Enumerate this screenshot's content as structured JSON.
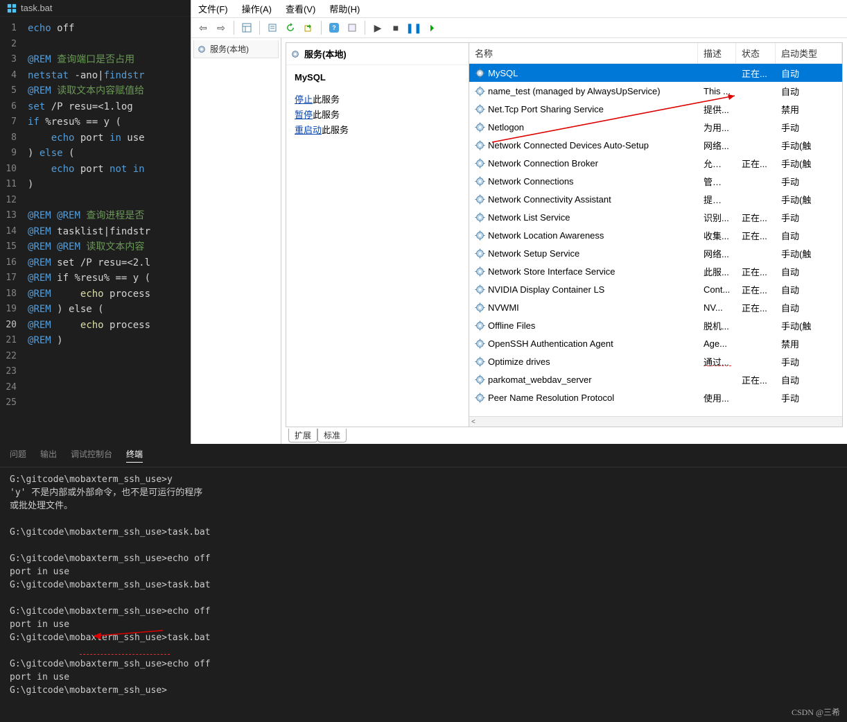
{
  "vscode": {
    "tab_name": "task.bat",
    "lines": [
      {
        "n": 1,
        "c": [
          [
            "kw",
            "echo"
          ],
          [
            "ident",
            " off"
          ]
        ]
      },
      {
        "n": 2,
        "c": []
      },
      {
        "n": 3,
        "c": [
          [
            "rem",
            "@"
          ],
          [
            "kw",
            "REM"
          ],
          [
            "cmt",
            " 查询端口是否占用"
          ]
        ]
      },
      {
        "n": 4,
        "c": [
          [
            "kw",
            "netstat"
          ],
          [
            "ident",
            " -ano|"
          ],
          [
            "kw",
            "findstr"
          ],
          [
            "ident",
            " "
          ]
        ]
      },
      {
        "n": 5,
        "c": [
          [
            "rem",
            "@"
          ],
          [
            "kw",
            "REM"
          ],
          [
            "cmt",
            " 读取文本内容赋值给"
          ]
        ]
      },
      {
        "n": 6,
        "c": [
          [
            "kw",
            "set"
          ],
          [
            "ident",
            " /P resu=<1.log"
          ]
        ]
      },
      {
        "n": 7,
        "c": [
          [
            "kw",
            "if"
          ],
          [
            "ident",
            " %resu% == y "
          ],
          [
            "op",
            "("
          ]
        ]
      },
      {
        "n": 8,
        "c": [
          [
            "ident",
            "    "
          ],
          [
            "kw",
            "echo"
          ],
          [
            "ident",
            " port "
          ],
          [
            "kw",
            "in"
          ],
          [
            "ident",
            " use"
          ]
        ]
      },
      {
        "n": 9,
        "c": [
          [
            "op",
            ")"
          ],
          [
            "ident",
            " "
          ],
          [
            "kw",
            "else"
          ],
          [
            "ident",
            " "
          ],
          [
            "op",
            "("
          ]
        ]
      },
      {
        "n": 10,
        "c": [
          [
            "ident",
            "    "
          ],
          [
            "kw",
            "echo"
          ],
          [
            "ident",
            " port "
          ],
          [
            "kw",
            "not"
          ],
          [
            "ident",
            " "
          ],
          [
            "kw",
            "in"
          ],
          [
            "ident",
            " "
          ]
        ]
      },
      {
        "n": 11,
        "c": [
          [
            "op",
            ")"
          ]
        ]
      },
      {
        "n": 12,
        "c": []
      },
      {
        "n": 13,
        "c": [
          [
            "rem",
            "@"
          ],
          [
            "kw",
            "REM"
          ],
          [
            "ident",
            " "
          ],
          [
            "rem",
            "@"
          ],
          [
            "kw",
            "REM"
          ],
          [
            "cmt",
            " 查询进程是否"
          ]
        ]
      },
      {
        "n": 14,
        "c": [
          [
            "rem",
            "@"
          ],
          [
            "kw",
            "REM"
          ],
          [
            "ident",
            " tasklist|findstr"
          ]
        ]
      },
      {
        "n": 15,
        "c": [
          [
            "rem",
            "@"
          ],
          [
            "kw",
            "REM"
          ],
          [
            "ident",
            " "
          ],
          [
            "rem",
            "@"
          ],
          [
            "kw",
            "REM"
          ],
          [
            "cmt",
            " 读取文本内容"
          ]
        ]
      },
      {
        "n": 16,
        "c": [
          [
            "rem",
            "@"
          ],
          [
            "kw",
            "REM"
          ],
          [
            "ident",
            " set /P resu=<2.l"
          ]
        ]
      },
      {
        "n": 17,
        "c": [
          [
            "rem",
            "@"
          ],
          [
            "kw",
            "REM"
          ],
          [
            "ident",
            " if %resu% == y ("
          ]
        ]
      },
      {
        "n": 18,
        "c": [
          [
            "rem",
            "@"
          ],
          [
            "kw",
            "REM"
          ],
          [
            "ident",
            "     "
          ],
          [
            "echo-w",
            "echo"
          ],
          [
            "ident",
            " process"
          ]
        ]
      },
      {
        "n": 19,
        "c": [
          [
            "rem",
            "@"
          ],
          [
            "kw",
            "REM"
          ],
          [
            "ident",
            " ) else ("
          ]
        ]
      },
      {
        "n": 20,
        "c": [
          [
            "rem",
            "@"
          ],
          [
            "kw",
            "REM"
          ],
          [
            "ident",
            "     "
          ],
          [
            "echo-w",
            "echo"
          ],
          [
            "ident",
            " process"
          ]
        ],
        "current": true
      },
      {
        "n": 21,
        "c": [
          [
            "rem",
            "@"
          ],
          [
            "kw",
            "REM"
          ],
          [
            "ident",
            " )"
          ]
        ]
      },
      {
        "n": 22,
        "c": []
      },
      {
        "n": 23,
        "c": []
      },
      {
        "n": 24,
        "c": []
      },
      {
        "n": 25,
        "c": []
      }
    ]
  },
  "terminal": {
    "tabs": [
      "问题",
      "输出",
      "调试控制台",
      "终端"
    ],
    "active_tab": 3,
    "body": "G:\\gitcode\\mobaxterm_ssh_use>y\n'y' 不是内部或外部命令，也不是可运行的程序\n或批处理文件。\n\nG:\\gitcode\\mobaxterm_ssh_use>task.bat\n\nG:\\gitcode\\mobaxterm_ssh_use>echo off\nport in use\nG:\\gitcode\\mobaxterm_ssh_use>task.bat\n\nG:\\gitcode\\mobaxterm_ssh_use>echo off\nport in use\nG:\\gitcode\\mobaxterm_ssh_use>task.bat\n\nG:\\gitcode\\mobaxterm_ssh_use>echo off\nport in use\nG:\\gitcode\\mobaxterm_ssh_use>"
  },
  "services": {
    "menu": [
      "文件(F)",
      "操作(A)",
      "查看(V)",
      "帮助(H)"
    ],
    "tree_label": "服务(本地)",
    "mid_header": "服务(本地)",
    "selected_service": "MySQL",
    "action_stop_prefix": "停止",
    "action_stop_suffix": "此服务",
    "action_pause_prefix": "暂停",
    "action_pause_suffix": "此服务",
    "action_restart_prefix": "重启动",
    "action_restart_suffix": "此服务",
    "columns": {
      "name": "名称",
      "desc": "描述",
      "status": "状态",
      "start": "启动类型"
    },
    "rows": [
      {
        "name": "MySQL",
        "desc": "",
        "status": "正在...",
        "start": "自动",
        "selected": true
      },
      {
        "name": "name_test (managed by AlwaysUpService)",
        "desc": "This ...",
        "status": "",
        "start": "自动"
      },
      {
        "name": "Net.Tcp Port Sharing Service",
        "desc": "提供...",
        "status": "",
        "start": "禁用"
      },
      {
        "name": "Netlogon",
        "desc": "为用...",
        "status": "",
        "start": "手动"
      },
      {
        "name": "Network Connected Devices Auto-Setup",
        "desc": "网络...",
        "status": "",
        "start": "手动(触"
      },
      {
        "name": "Network Connection Broker",
        "desc": "允许 ...",
        "status": "正在...",
        "start": "手动(触"
      },
      {
        "name": "Network Connections",
        "desc": "管理\"...",
        "status": "",
        "start": "手动"
      },
      {
        "name": "Network Connectivity Assistant",
        "desc": "提供 ...",
        "status": "",
        "start": "手动(触"
      },
      {
        "name": "Network List Service",
        "desc": "识别...",
        "status": "正在...",
        "start": "手动"
      },
      {
        "name": "Network Location Awareness",
        "desc": "收集...",
        "status": "正在...",
        "start": "自动"
      },
      {
        "name": "Network Setup Service",
        "desc": "网络...",
        "status": "",
        "start": "手动(触"
      },
      {
        "name": "Network Store Interface Service",
        "desc": "此服...",
        "status": "正在...",
        "start": "自动"
      },
      {
        "name": "NVIDIA Display Container LS",
        "desc": "Cont...",
        "status": "正在...",
        "start": "自动"
      },
      {
        "name": "NVWMI",
        "desc": "NV...",
        "status": "正在...",
        "start": "自动"
      },
      {
        "name": "Offline Files",
        "desc": "脱机...",
        "status": "",
        "start": "手动(触"
      },
      {
        "name": "OpenSSH Authentication Agent",
        "desc": "Age...",
        "status": "",
        "start": "禁用"
      },
      {
        "name": "Optimize drives",
        "desc": "通过...",
        "status": "",
        "start": "手动"
      },
      {
        "name": "parkomat_webdav_server",
        "desc": "",
        "status": "正在...",
        "start": "自动"
      },
      {
        "name": "Peer Name Resolution Protocol",
        "desc": "使用...",
        "status": "",
        "start": "手动"
      }
    ],
    "bottom_tabs": [
      "扩展",
      "标准"
    ]
  },
  "watermark": "CSDN @三希"
}
